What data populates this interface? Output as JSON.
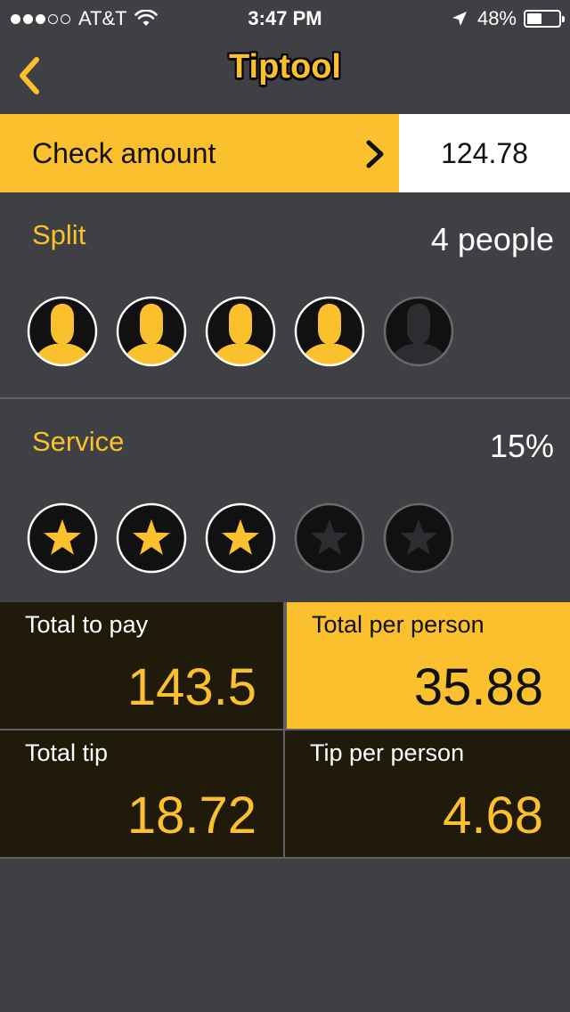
{
  "status_bar": {
    "signal_bars_on": 3,
    "signal_bars_total": 5,
    "carrier": "AT&T",
    "time": "3:47 PM",
    "battery": "48%",
    "battery_level": 0.48
  },
  "nav": {
    "title": "Tiptool",
    "back_icon": "chevron-left-icon"
  },
  "check": {
    "label": "Check amount",
    "value": "124.78"
  },
  "split": {
    "label": "Split",
    "value": "4 people",
    "selected": 4,
    "max": 5,
    "icon": "person-icon"
  },
  "service": {
    "label": "Service",
    "value": "15%",
    "rating": 3,
    "max": 5,
    "icon": "star-icon"
  },
  "totals": [
    {
      "label": "Total to pay",
      "value": "143.5",
      "highlight": false
    },
    {
      "label": "Total per person",
      "value": "35.88",
      "highlight": true
    },
    {
      "label": "Total tip",
      "value": "18.72",
      "highlight": false
    },
    {
      "label": "Tip per person",
      "value": "4.68",
      "highlight": false
    }
  ],
  "colors": {
    "accent": "#fbc02d",
    "background": "#3f4043",
    "tile_dark": "#201a0b",
    "inactive": "#2c2d30"
  }
}
